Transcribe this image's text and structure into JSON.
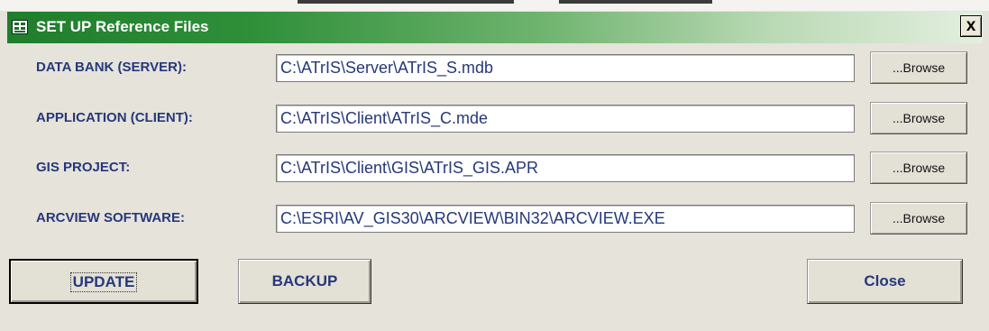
{
  "window": {
    "title": "SET UP Reference Files",
    "close_glyph": "x",
    "icon": "form-icon"
  },
  "rows": [
    {
      "label": "DATA BANK (SERVER):",
      "value": "C:\\ATrIS\\Server\\ATrIS_S.mdb",
      "browse": "...Browse"
    },
    {
      "label": "APPLICATION (CLIENT):",
      "value": "C:\\ATrIS\\Client\\ATrIS_C.mde",
      "browse": "...Browse"
    },
    {
      "label": "GIS PROJECT:",
      "value": "C:\\ATrIS\\Client\\GIS\\ATrIS_GIS.APR",
      "browse": "...Browse"
    },
    {
      "label": "ARCVIEW SOFTWARE:",
      "value": "C:\\ESRI\\AV_GIS30\\ARCVIEW\\BIN32\\ARCVIEW.EXE",
      "browse": "...Browse"
    }
  ],
  "buttons": {
    "update": "UPDATE",
    "backup": "BACKUP",
    "close": "Close"
  },
  "colors": {
    "title_start": "#1f7d2c",
    "label_text": "#26387a",
    "dialog_bg": "#e6e3db"
  }
}
